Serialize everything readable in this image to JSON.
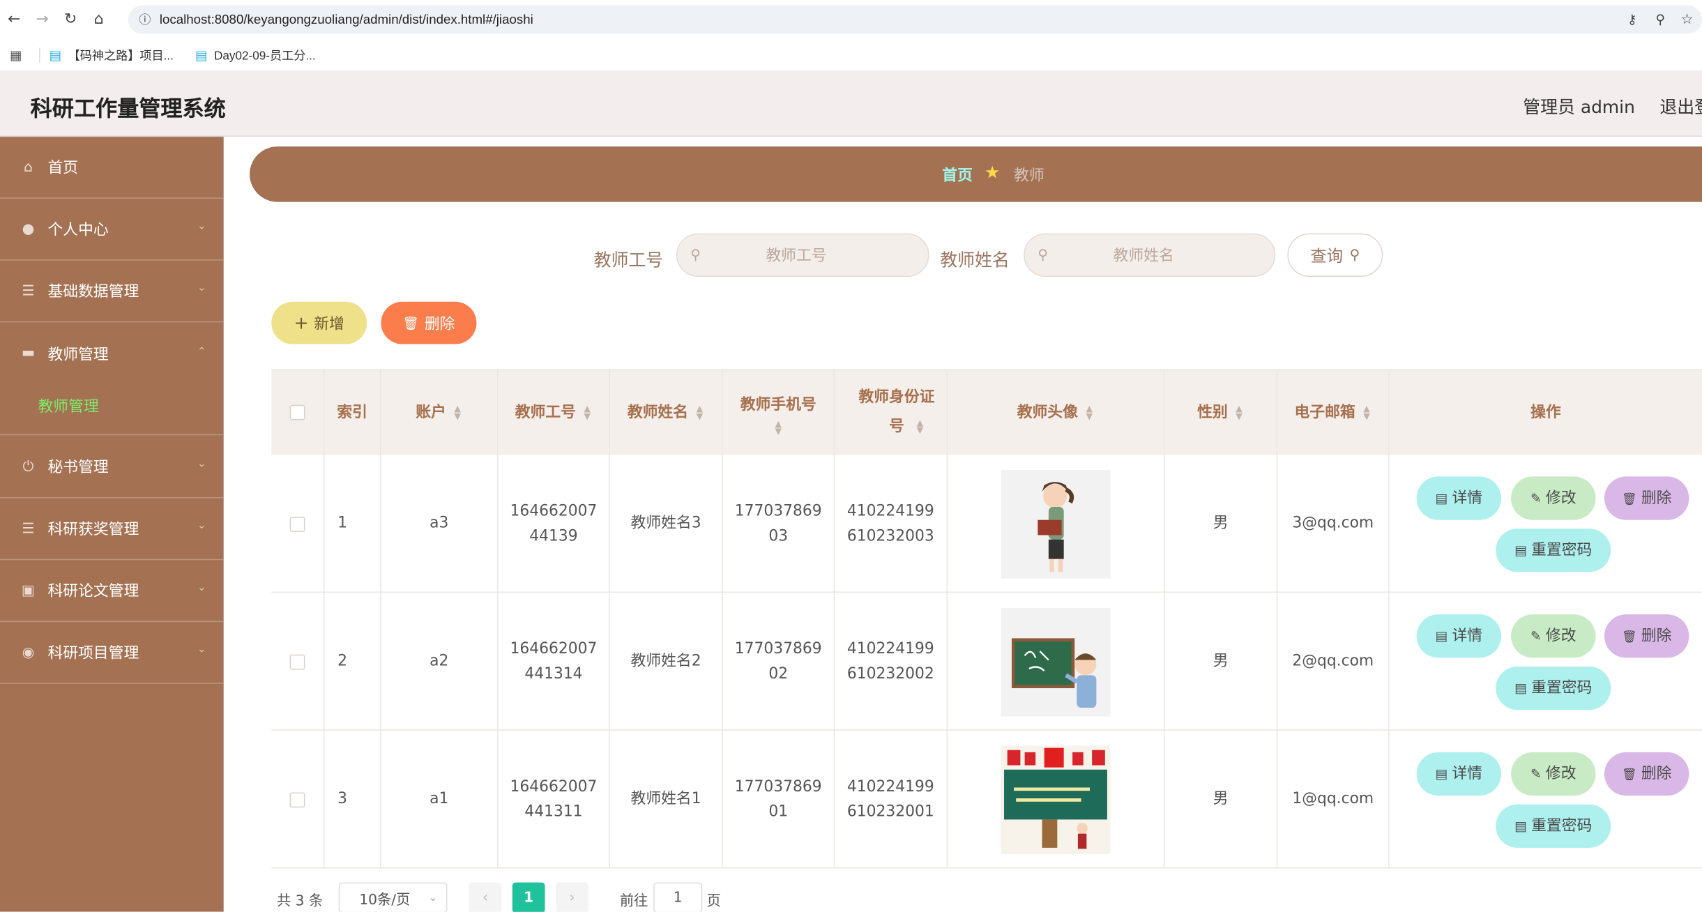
{
  "browser": {
    "url": "localhost:8080/keyangongzuoliang/admin/dist/index.html#/jiaoshi",
    "bookmarks": [
      "【码神之路】项目...",
      "Day02-09-员工分..."
    ]
  },
  "header": {
    "title": "科研工作量管理系统",
    "user": "管理员 admin",
    "logout": "退出登"
  },
  "sidebar": {
    "items": [
      {
        "label": "首页",
        "icon": "home-icon"
      },
      {
        "label": "个人中心",
        "icon": "user-icon"
      },
      {
        "label": "基础数据管理",
        "icon": "sliders-icon"
      },
      {
        "label": "教师管理",
        "icon": "ticket-icon"
      },
      {
        "label": "秘书管理",
        "icon": "power-icon"
      },
      {
        "label": "科研获奖管理",
        "icon": "list-icon"
      },
      {
        "label": "科研论文管理",
        "icon": "monitor-icon"
      },
      {
        "label": "科研项目管理",
        "icon": "bulb-icon"
      }
    ],
    "active_sub": "教师管理"
  },
  "breadcrumb": {
    "home": "首页",
    "current": "教师"
  },
  "search": {
    "field1_label": "教师工号",
    "field1_placeholder": "教师工号",
    "field2_label": "教师姓名",
    "field2_placeholder": "教师姓名",
    "query_btn": "查询"
  },
  "actions": {
    "add": "新增",
    "delete": "删除"
  },
  "table": {
    "headers": {
      "index": "索引",
      "account": "账户",
      "no": "教师工号",
      "name": "教师姓名",
      "phone": "教师手机号",
      "idcard": "教师身份证号",
      "avatar": "教师头像",
      "gender": "性别",
      "email": "电子邮箱",
      "ops": "操作"
    },
    "rows": [
      {
        "index": "1",
        "account": "a3",
        "no": "16466200744139",
        "name": "教师姓名3",
        "phone": "17703786903",
        "idcard": "410224199610232003",
        "avatar": "teacher-with-book",
        "gender": "男",
        "email": "3@qq.com"
      },
      {
        "index": "2",
        "account": "a2",
        "no": "164662007441314",
        "name": "教师姓名2",
        "phone": "17703786902",
        "idcard": "410224199610232002",
        "avatar": "teacher-at-blackboard",
        "gender": "男",
        "email": "2@qq.com"
      },
      {
        "index": "3",
        "account": "a1",
        "no": "164662007441311",
        "name": "教师姓名1",
        "phone": "17703786901",
        "idcard": "410224199610232001",
        "avatar": "teachers-day-board",
        "gender": "男",
        "email": "1@qq.com"
      }
    ],
    "row_actions": {
      "detail": "详情",
      "edit": "修改",
      "delete": "删除",
      "reset": "重置密码"
    }
  },
  "pagination": {
    "total": "共 3 条",
    "page_size": "10条/页",
    "current_page": "1",
    "goto_label": "前往",
    "goto_value": "1",
    "page_suffix": "页"
  },
  "colors": {
    "sidebar": "#a47253",
    "accent_green": "#1fc29a",
    "header_bg": "#f4eded"
  }
}
